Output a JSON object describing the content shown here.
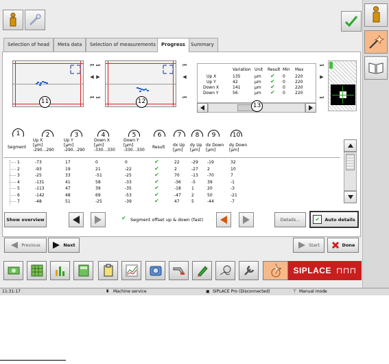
{
  "top_buttons": {
    "info_icon": "info-icon",
    "pin_icon": "pin-icon"
  },
  "tabs": [
    {
      "label": "Selection of head"
    },
    {
      "label": "Meta data"
    },
    {
      "label": "Selection of measurements"
    },
    {
      "label": "Progress"
    },
    {
      "label": "Summary"
    }
  ],
  "plots": {
    "left": {
      "marker": "11"
    },
    "right": {
      "marker": "12"
    }
  },
  "variation_table": {
    "headers": [
      "Variation",
      "Unit",
      "Result",
      "Min",
      "Max"
    ],
    "rows": [
      {
        "label": "Up X",
        "variation": "135",
        "unit": "µm",
        "min": "0",
        "max": "220"
      },
      {
        "label": "Up Y",
        "variation": "42",
        "unit": "µm",
        "min": "0",
        "max": "220"
      },
      {
        "label": "Down X",
        "variation": "141",
        "unit": "µm",
        "min": "0",
        "max": "220"
      },
      {
        "label": "Down Y",
        "variation": "56",
        "unit": "µm",
        "min": "0",
        "max": "220"
      }
    ],
    "marker": "13"
  },
  "markers": [
    "1",
    "2",
    "3",
    "4",
    "5",
    "6",
    "7",
    "8",
    "9",
    "10"
  ],
  "table": {
    "headers": {
      "segment": "Segment",
      "upx": [
        "Up X",
        "[µm]",
        "-290...290"
      ],
      "upy": [
        "Up Y",
        "[µm]",
        "-290...290"
      ],
      "downx": [
        "Down X",
        "[µm]",
        "-330...330"
      ],
      "downy": [
        "Down Y",
        "[µm]",
        "-330...330"
      ],
      "result": "Result",
      "dxup": [
        "dx Up",
        "[µm]"
      ],
      "dyup": [
        "dy Up",
        "[µm]"
      ],
      "dxdown": [
        "dx Down",
        "[µm]"
      ],
      "dydown": [
        "dy Down",
        "[µm]"
      ]
    },
    "rows": [
      [
        "1",
        "-73",
        "17",
        "0",
        "0",
        "22",
        "-29",
        "-19",
        "32"
      ],
      [
        "2",
        "-93",
        "19",
        "21",
        "-22",
        "2",
        "-27",
        "2",
        "10"
      ],
      [
        "3",
        "-25",
        "33",
        "-51",
        "-25",
        "70",
        "-13",
        "-70",
        "7"
      ],
      [
        "4",
        "-131",
        "41",
        "58",
        "-33",
        "-36",
        "-5",
        "39",
        "-1"
      ],
      [
        "5",
        "-113",
        "47",
        "39",
        "-35",
        "-18",
        "1",
        "20",
        "-3"
      ],
      [
        "6",
        "-142",
        "48",
        "69",
        "-53",
        "-47",
        "2",
        "50",
        "-21"
      ],
      [
        "7",
        "-48",
        "51",
        "-25",
        "-39",
        "47",
        "5",
        "-44",
        "-7"
      ]
    ]
  },
  "controls": {
    "show_overview": "Show overview",
    "segment_offset": "Segment offset up & down (fast)",
    "details": "Details...",
    "auto_details": "Auto details"
  },
  "nav": {
    "previous": "Previous",
    "next": "Next",
    "start": "Start",
    "done": "Done"
  },
  "brand": {
    "name": "SIPLACE",
    "mark": "⊓⊓⊓"
  },
  "status": {
    "time": "11:31:17",
    "service": "Machine service",
    "connection": "SIPLACE Pro (Disconnected)",
    "mode": "Manual mode"
  },
  "colors": {
    "accent_orange": "#f7b98a",
    "brand_red": "#c81e1e",
    "check_green": "#2ea82e",
    "plot_dot": "#1e5bd6"
  }
}
